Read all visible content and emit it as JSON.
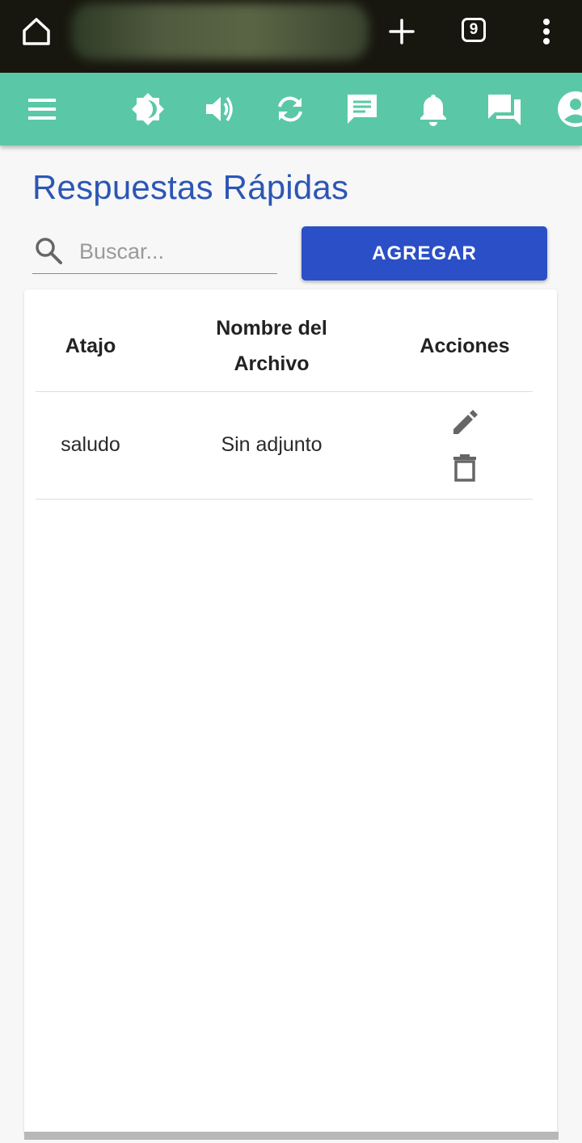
{
  "browser": {
    "tab_count": "9",
    "icons": [
      "home-icon",
      "plus-icon",
      "tabs-icon",
      "more-vert-icon"
    ]
  },
  "app_bar": {
    "icons": [
      "menu-icon",
      "brightness-icon",
      "volume-icon",
      "sync-icon",
      "message-icon",
      "notifications-icon",
      "forum-icon",
      "account-icon"
    ],
    "color": "#5ac8a6"
  },
  "page": {
    "title": "Respuestas Rápidas",
    "search_placeholder": "Buscar...",
    "add_label": "AGREGAR"
  },
  "table": {
    "headers": [
      "Atajo",
      "Nombre del Archivo",
      "Acciones"
    ],
    "rows": [
      {
        "shortcut": "saludo",
        "file": "Sin adjunto",
        "actions": [
          "edit-icon",
          "delete-icon"
        ]
      }
    ]
  },
  "colors": {
    "title": "#2c56b5",
    "button": "#2b4fc6"
  }
}
